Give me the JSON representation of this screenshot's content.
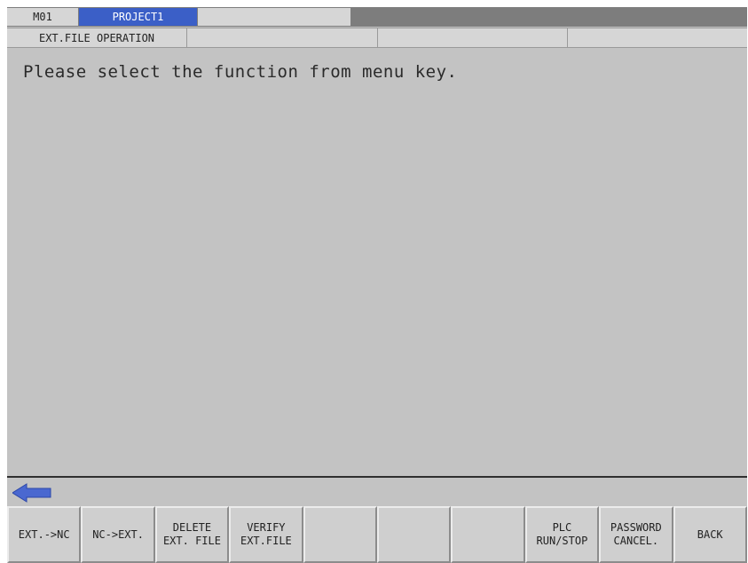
{
  "header": {
    "machine": "M01",
    "project": "PROJECT1"
  },
  "subheader": {
    "screen_title": "EXT.FILE OPERATION"
  },
  "main": {
    "message": "Please select the function from menu key."
  },
  "menu_keys": [
    "EXT.->NC",
    "NC->EXT.",
    "DELETE\nEXT. FILE",
    "VERIFY\nEXT.FILE",
    "",
    "",
    "",
    "PLC\nRUN/STOP",
    "PASSWORD\nCANCEL.",
    "BACK"
  ],
  "icons": {
    "previous_menu": "left-arrow-icon"
  },
  "colors": {
    "project_tab": "#3b5fc7",
    "background": "#c3c3c3",
    "arrow": "#4a68d0"
  }
}
